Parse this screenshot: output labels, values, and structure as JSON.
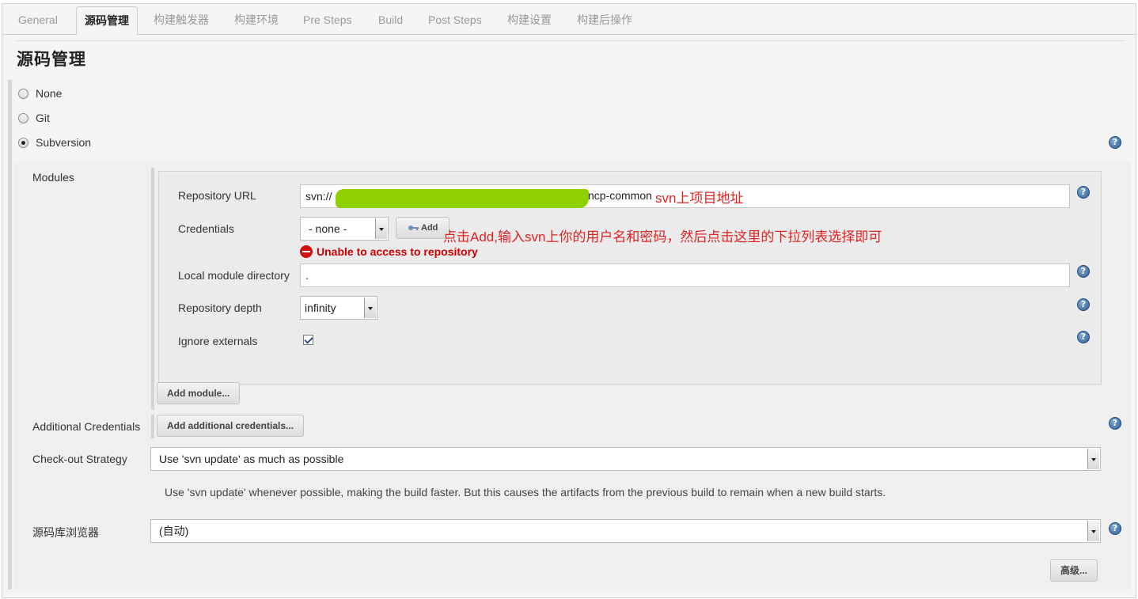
{
  "tabs": [
    {
      "label": "General"
    },
    {
      "label": "源码管理"
    },
    {
      "label": "构建触发器"
    },
    {
      "label": "构建环境"
    },
    {
      "label": "Pre Steps"
    },
    {
      "label": "Build"
    },
    {
      "label": "Post Steps"
    },
    {
      "label": "构建设置"
    },
    {
      "label": "构建后操作"
    }
  ],
  "active_tab": "源码管理",
  "section_title": "源码管理",
  "scm_options": [
    {
      "label": "None",
      "checked": false
    },
    {
      "label": "Git",
      "checked": false
    },
    {
      "label": "Subversion",
      "checked": true
    }
  ],
  "modules": {
    "label": "Modules",
    "repository_url": {
      "label": "Repository URL",
      "value_prefix": "svn://",
      "value_suffix": "ncp-common"
    },
    "credentials": {
      "label": "Credentials",
      "selected": "- none -",
      "add_label": "Add"
    },
    "error": "Unable to access to repository",
    "local_dir": {
      "label": "Local module directory",
      "value": "."
    },
    "depth": {
      "label": "Repository depth",
      "selected": "infinity"
    },
    "ignore_externals": {
      "label": "Ignore externals",
      "checked": true
    },
    "add_module_label": "Add module..."
  },
  "annotations": {
    "url_note": "svn上项目地址",
    "credentials_note": "点击Add,输入svn上你的用户名和密码，然后点击这里的下拉列表选择即可"
  },
  "additional_credentials": {
    "label": "Additional Credentials",
    "button_label": "Add additional credentials..."
  },
  "checkout_strategy": {
    "label": "Check-out Strategy",
    "selected": "Use 'svn update' as much as possible",
    "description": "Use 'svn update' whenever possible, making the build faster. But this causes the artifacts from the previous build to remain when a new build starts."
  },
  "repo_browser": {
    "label": "源码库浏览器",
    "selected": "(自动)"
  },
  "advanced_label": "高级...",
  "help_glyph": "?",
  "icons": {
    "help": "help-icon",
    "error": "error-icon",
    "key": "key-icon"
  },
  "colors": {
    "annotation": "#e02222",
    "error": "#cc0000",
    "redaction": "#8fd100",
    "help": "#2f5f9a"
  }
}
